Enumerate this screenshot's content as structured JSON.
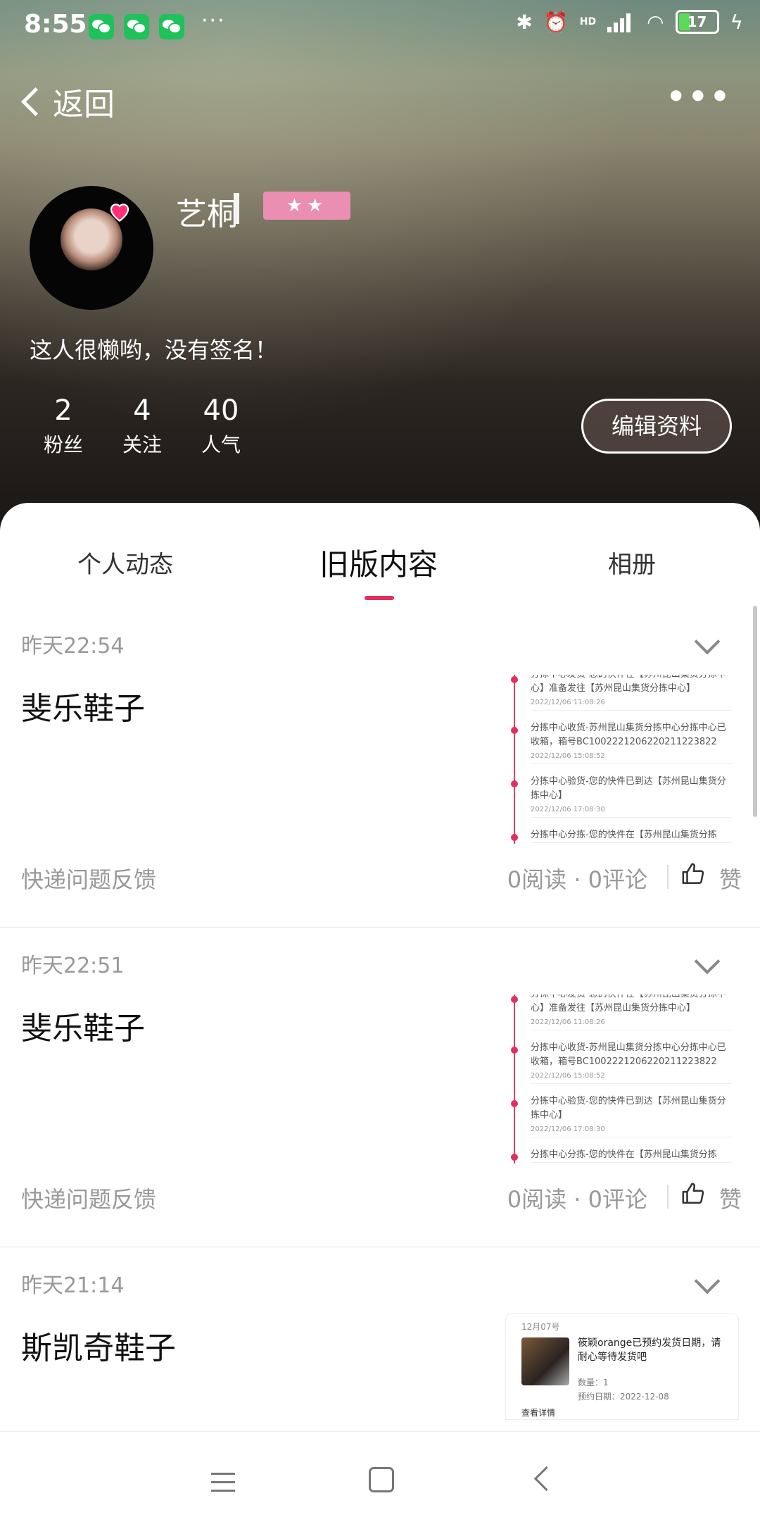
{
  "status": {
    "time": "8:55",
    "more": "···",
    "hd": "HD",
    "battery": "17"
  },
  "nav": {
    "back_label": "返回",
    "more": "•••"
  },
  "profile": {
    "name": "艺桐",
    "stars": "★★",
    "signature": "这人很懒哟，没有签名！",
    "stats": [
      {
        "value": "2",
        "label": "粉丝"
      },
      {
        "value": "4",
        "label": "关注"
      },
      {
        "value": "40",
        "label": "人气"
      }
    ],
    "edit_button": "编辑资料"
  },
  "tabs": [
    {
      "label": "个人动态"
    },
    {
      "label": "旧版内容"
    },
    {
      "label": "相册"
    }
  ],
  "posts": [
    {
      "time": "昨天22:54",
      "title": "斐乐鞋子",
      "category": "快递问题反馈",
      "meta": "0阅读 · 0评论",
      "like": "赞",
      "timeline": [
        {
          "text": "分拣中心发货-您的快件在【苏州昆山集货分拣中心】准备发往【苏州昆山集货分拣中心】",
          "date": "2022/12/06 11:08:26"
        },
        {
          "text": "分拣中心收货-苏州昆山集货分拣中心分拣中心已收箱，箱号BC1002221206220211223822",
          "date": "2022/12/06 15:08:52"
        },
        {
          "text": "分拣中心验货-您的快件已到达【苏州昆山集货分拣中心】",
          "date": "2022/12/06 17:08:30"
        },
        {
          "text": "分拣中心分拣-您的快件在【苏州昆山集货分拣",
          "date": ""
        }
      ]
    },
    {
      "time": "昨天22:51",
      "title": "斐乐鞋子",
      "category": "快递问题反馈",
      "meta": "0阅读 · 0评论",
      "like": "赞",
      "timeline": [
        {
          "text": "分拣中心发货-您的快件在【苏州昆山集货分拣中心】准备发往【苏州昆山集货分拣中心】",
          "date": "2022/12/06 11:08:26"
        },
        {
          "text": "分拣中心收货-苏州昆山集货分拣中心分拣中心已收箱，箱号BC1002221206220211223822",
          "date": "2022/12/06 15:08:52"
        },
        {
          "text": "分拣中心验货-您的快件已到达【苏州昆山集货分拣中心】",
          "date": "2022/12/06 17:08:30"
        },
        {
          "text": "分拣中心分拣-您的快件在【苏州昆山集货分拣",
          "date": ""
        }
      ]
    },
    {
      "time": "昨天21:14",
      "title": "斯凯奇鞋子",
      "order": {
        "date": "12月07号",
        "text": "筱颖orange已预约发货日期，请耐心等待发货吧",
        "qty": "数量：1",
        "appt": "预约日期：2022-12-08",
        "link": "查看详情"
      }
    }
  ],
  "colors": {
    "accent": "#e03060",
    "badge": "#ea8fb2"
  }
}
